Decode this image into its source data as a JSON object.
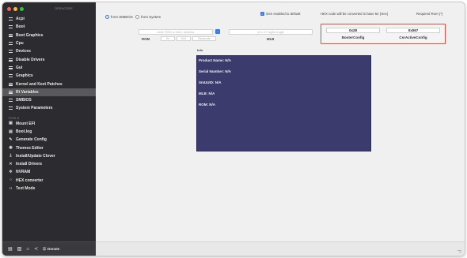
{
  "app": {
    "version_label": "OPENCORE"
  },
  "sidebar": {
    "items": [
      {
        "label": "Acpi",
        "icon": "list-icon"
      },
      {
        "label": "Boot",
        "icon": "list-icon"
      },
      {
        "label": "Boot Graphics",
        "icon": "list-icon"
      },
      {
        "label": "Cpu",
        "icon": "list-icon"
      },
      {
        "label": "Devices",
        "icon": "list-icon"
      },
      {
        "label": "Disable Drivers",
        "icon": "list-icon"
      },
      {
        "label": "Gui",
        "icon": "list-icon"
      },
      {
        "label": "Graphics",
        "icon": "list-icon"
      },
      {
        "label": "Kernel and Kext Patches",
        "icon": "list-icon"
      },
      {
        "label": "Rt Variables",
        "icon": "list-icon",
        "selected": true
      },
      {
        "label": "SMBIOS",
        "icon": "list-icon"
      },
      {
        "label": "System Parameters",
        "icon": "list-icon"
      }
    ],
    "tools_section_label": "TOOLS",
    "tools": [
      {
        "label": "Mount EFI",
        "icon": "disk-icon"
      },
      {
        "label": "Boot.log",
        "icon": "doc-icon"
      },
      {
        "label": "Generate Config",
        "icon": "magic-icon"
      },
      {
        "label": "Themes Editor",
        "icon": "eye-icon"
      },
      {
        "label": "Install/Update Clover",
        "icon": "download-icon"
      },
      {
        "label": "Install Drivers",
        "icon": "tools-icon"
      },
      {
        "label": "NVRAM",
        "icon": "gear-icon"
      },
      {
        "label": "HEX converter",
        "icon": "circle-icon"
      },
      {
        "label": "Text Mode",
        "icon": "code-icon"
      }
    ],
    "bottom": {
      "donate_label": "Donate"
    }
  },
  "main": {
    "source_options": {
      "from_smbios": "from SMBIOS",
      "from_system": "from System",
      "selected": "from SMBIOS"
    },
    "default_checkbox_label": "Gen enabled to default",
    "hex_note": "HEX code will be converted in base 64 (Hex)",
    "required_note": "Required Rom (*)",
    "rom_field_placeholder": "write ROM or MAC address",
    "rom_label": "ROM",
    "rom_small_1": "0x",
    "rom_small_2": "0x0",
    "generate_label": "Generate",
    "mlb_field_placeholder": "13 o 17 digits length",
    "mlb_label": "MLB",
    "booter_value": "0x28",
    "csr_value": "0x067",
    "booter_label": "BooterConfig",
    "csr_label": "CsrActiveConfig",
    "info_section_label": "Info",
    "info_lines": [
      "Product Name: N/A",
      "Serial Number: N/A",
      "SmUUID: N/A",
      "MLB: N/A",
      "ROM: N/A"
    ]
  },
  "colors": {
    "sidebar_bg": "#2c2c30",
    "accent": "#2f7bf5",
    "highlight_border": "#e5493a",
    "info_panel_bg": "#3c3b6e"
  }
}
